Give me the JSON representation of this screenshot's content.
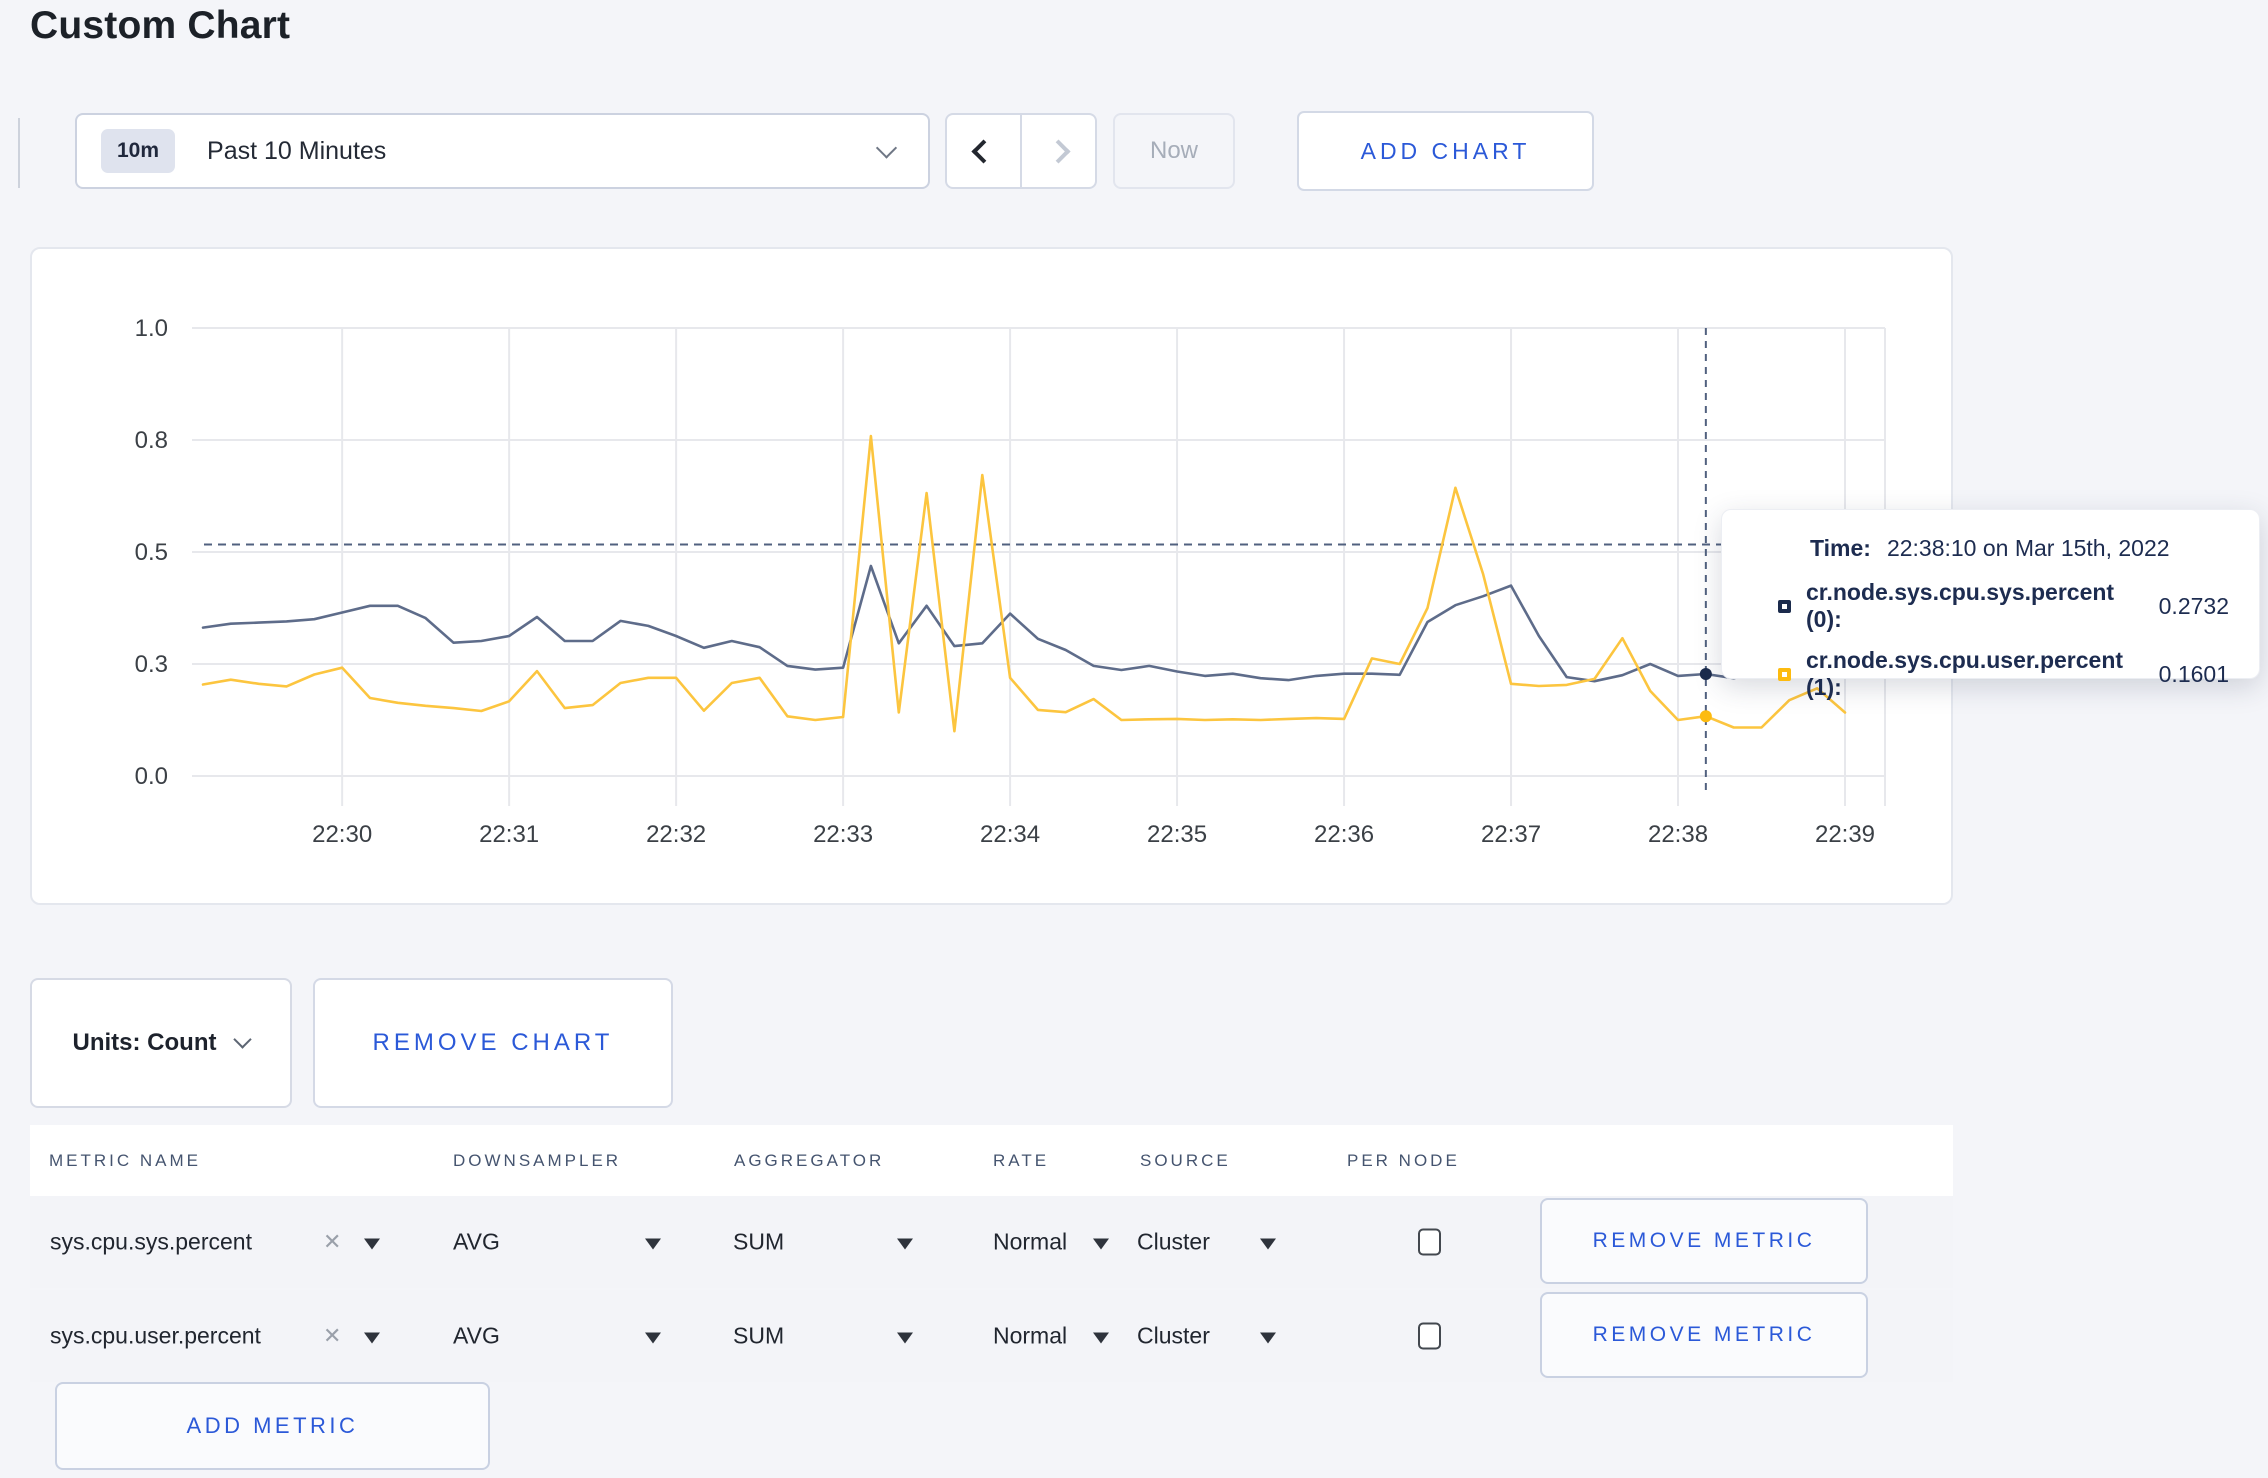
{
  "page": {
    "title": "Custom Chart"
  },
  "colors": {
    "accent_blue": "#2b59d8",
    "page_background": "#f4f5f9",
    "grid_line": "#e7e8ec",
    "crosshair": "#51617f",
    "axis_text": "#3b4046"
  },
  "toolbar": {
    "time_badge": "10m",
    "time_label": "Past 10 Minutes",
    "now_label": "Now",
    "add_chart_label": "ADD CHART"
  },
  "chart_data": {
    "type": "line",
    "title": "",
    "xlabel": "",
    "ylabel": "",
    "ylim": [
      0,
      1.0
    ],
    "grid": true,
    "legend_position": "tooltip",
    "y_ticks": [
      0,
      0.3,
      0.5,
      0.8,
      1.0
    ],
    "y_tick_labels": [
      "0.0",
      "0.3",
      "0.5",
      "0.8",
      "1.0"
    ],
    "x_tick_labels": [
      "22:30",
      "22:31",
      "22:32",
      "22:33",
      "22:34",
      "22:35",
      "22:36",
      "22:37",
      "22:38",
      "22:39"
    ],
    "threshold_line": 0.52,
    "crosshair_time": "22:38:10",
    "x_times": [
      "22:29:10",
      "22:29:20",
      "22:29:30",
      "22:29:40",
      "22:29:50",
      "22:30:00",
      "22:30:10",
      "22:30:20",
      "22:30:30",
      "22:30:40",
      "22:30:50",
      "22:31:00",
      "22:31:10",
      "22:31:20",
      "22:31:30",
      "22:31:40",
      "22:31:50",
      "22:32:00",
      "22:32:10",
      "22:32:20",
      "22:32:30",
      "22:32:40",
      "22:32:50",
      "22:33:00",
      "22:33:10",
      "22:33:20",
      "22:33:30",
      "22:33:40",
      "22:33:50",
      "22:34:00",
      "22:34:10",
      "22:34:20",
      "22:34:30",
      "22:34:40",
      "22:34:50",
      "22:35:00",
      "22:35:10",
      "22:35:20",
      "22:35:30",
      "22:35:40",
      "22:35:50",
      "22:36:00",
      "22:36:10",
      "22:36:20",
      "22:36:30",
      "22:36:40",
      "22:36:50",
      "22:37:00",
      "22:37:10",
      "22:37:20",
      "22:37:30",
      "22:37:40",
      "22:37:50",
      "22:38:00",
      "22:38:10",
      "22:38:20",
      "22:38:30",
      "22:38:40",
      "22:38:50",
      "22:39:00"
    ],
    "series": [
      {
        "name": "cr.node.sys.cpu.sys.percent",
        "line_color": "#5e6c8a",
        "swatch_color": "#1b2b4c",
        "crosshair_value": 0.2732,
        "values": [
          0.365,
          0.372,
          0.374,
          0.376,
          0.38,
          0.392,
          0.404,
          0.404,
          0.382,
          0.338,
          0.341,
          0.35,
          0.384,
          0.341,
          0.341,
          0.377,
          0.368,
          0.35,
          0.329,
          0.341,
          0.33,
          0.295,
          0.285,
          0.29,
          0.475,
          0.337,
          0.404,
          0.332,
          0.337,
          0.39,
          0.345,
          0.325,
          0.295,
          0.284,
          0.295,
          0.28,
          0.268,
          0.274,
          0.262,
          0.257,
          0.268,
          0.274,
          0.274,
          0.271,
          0.375,
          0.405,
          0.421,
          0.44,
          0.35,
          0.265,
          0.254,
          0.27,
          0.3,
          0.268,
          0.2732,
          0.262,
          0.28,
          0.295,
          0.3,
          0.298
        ]
      },
      {
        "name": "cr.node.sys.cpu.user.percent",
        "line_color": "#fcc53f",
        "swatch_color": "#fdbb0f",
        "crosshair_value": 0.1601,
        "values": [
          0.245,
          0.258,
          0.247,
          0.24,
          0.272,
          0.29,
          0.209,
          0.196,
          0.188,
          0.182,
          0.174,
          0.2,
          0.281,
          0.182,
          0.19,
          0.249,
          0.263,
          0.263,
          0.175,
          0.249,
          0.263,
          0.16,
          0.15,
          0.158,
          0.807,
          0.17,
          0.658,
          0.12,
          0.706,
          0.263,
          0.177,
          0.171,
          0.206,
          0.15,
          0.152,
          0.153,
          0.15,
          0.152,
          0.15,
          0.153,
          0.155,
          0.153,
          0.31,
          0.3,
          0.4,
          0.672,
          0.46,
          0.247,
          0.241,
          0.244,
          0.26,
          0.346,
          0.228,
          0.15,
          0.1601,
          0.13,
          0.13,
          0.203,
          0.235,
          0.17
        ]
      }
    ]
  },
  "tooltip": {
    "time_label": "Time:",
    "time_value": "22:38:10 on Mar 15th, 2022",
    "series": [
      {
        "name": "cr.node.sys.cpu.sys.percent (0):",
        "value": "0.2732"
      },
      {
        "name": "cr.node.sys.cpu.user.percent (1):",
        "value": "0.1601"
      }
    ]
  },
  "footer": {
    "units_label": "Units: Count",
    "remove_chart_label": "REMOVE CHART"
  },
  "metrics_table": {
    "headers": [
      "METRIC NAME",
      "DOWNSAMPLER",
      "AGGREGATOR",
      "RATE",
      "SOURCE",
      "PER NODE"
    ],
    "add_metric_label": "ADD METRIC",
    "rows": [
      {
        "metric": "sys.cpu.sys.percent",
        "clear_icon": "✕",
        "downsampler": "AVG",
        "aggregator": "SUM",
        "rate": "Normal",
        "source": "Cluster",
        "per_node_checked": false,
        "remove_label": "REMOVE METRIC"
      },
      {
        "metric": "sys.cpu.user.percent",
        "clear_icon": "✕",
        "downsampler": "AVG",
        "aggregator": "SUM",
        "rate": "Normal",
        "source": "Cluster",
        "per_node_checked": false,
        "remove_label": "REMOVE METRIC"
      }
    ]
  }
}
